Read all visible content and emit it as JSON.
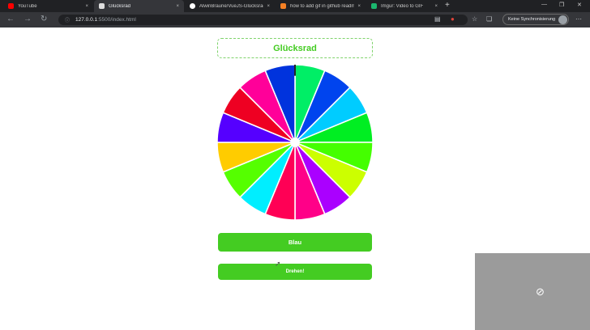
{
  "browser": {
    "tabs": [
      {
        "label": "YouTube",
        "favicon_color": "#ff0000",
        "active": false
      },
      {
        "label": "Glücksrad",
        "favicon_color": "#dddddd",
        "active": true
      },
      {
        "label": "AlwinBraune/VueJS-Glücksrad",
        "favicon_color": "#ffffff",
        "active": false
      },
      {
        "label": "how to add gif in github readme",
        "favicon_color": "#f48024",
        "active": false
      },
      {
        "label": "Imgur: Video to GIF",
        "favicon_color": "#1bb76e",
        "active": false
      }
    ],
    "close_glyph": "×",
    "new_tab_glyph": "+",
    "url_host": "127.0.0.1",
    "url_rest": ":5500/index.html",
    "sync_label": "Keine Synchronisierung"
  },
  "page": {
    "title": "Glücksrad",
    "result_label": "Blau",
    "spin_label": "Drehen!",
    "accent_color": "#44cc22"
  },
  "wheel": {
    "segment_colors": [
      "#00ee66",
      "#0044ee",
      "#00ccff",
      "#00ee22",
      "#44ff00",
      "#ccff00",
      "#aa00ff",
      "#ff0088",
      "#ff0055",
      "#00eeff",
      "#55ff00",
      "#ffcc00",
      "#5500ff",
      "#ee0022",
      "#ff0099",
      "#0033dd"
    ],
    "pointer_color": "#222222"
  }
}
